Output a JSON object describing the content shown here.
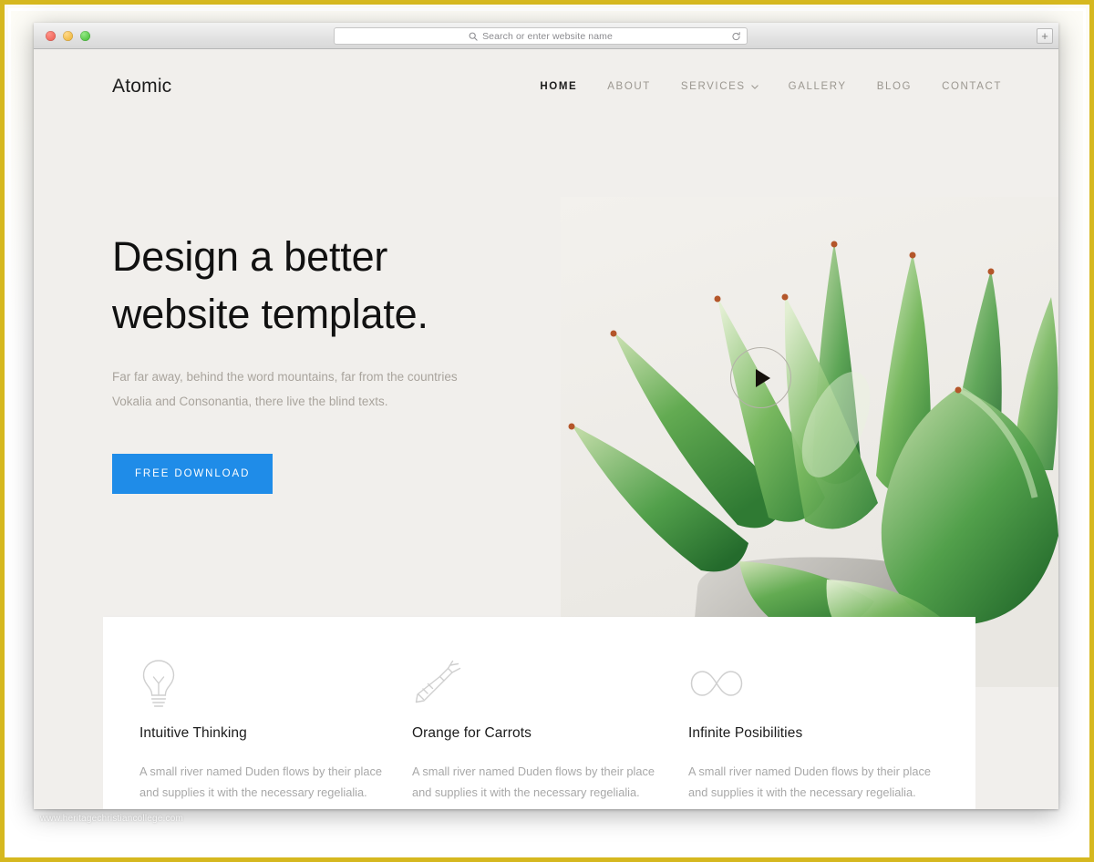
{
  "browser": {
    "address_placeholder": "Search or enter website name",
    "search_icon": "search-icon",
    "reload_icon": "reload-icon",
    "new_tab_label": "+",
    "traffic_lights": [
      "close",
      "minimize",
      "maximize"
    ]
  },
  "site": {
    "logo": "Atomic",
    "nav": [
      {
        "label": "HOME",
        "active": true,
        "has_caret": false
      },
      {
        "label": "ABOUT",
        "active": false,
        "has_caret": false
      },
      {
        "label": "SERVICES",
        "active": false,
        "has_caret": true
      },
      {
        "label": "GALLERY",
        "active": false,
        "has_caret": false
      },
      {
        "label": "BLOG",
        "active": false,
        "has_caret": false
      },
      {
        "label": "CONTACT",
        "active": false,
        "has_caret": false
      }
    ]
  },
  "hero": {
    "title_line1": "Design a better",
    "title_line2": "website template.",
    "subtitle": "Far far away, behind the word mountains, far from the countries Vokalia and Consonantia, there live the blind texts.",
    "cta_label": "FREE DOWNLOAD",
    "play_button_name": "play-video-button",
    "image_alt": "succulent-plant-in-grey-pot"
  },
  "features": [
    {
      "icon": "lightbulb-icon",
      "title": "Intuitive Thinking",
      "body": "A small river named Duden flows by their place and supplies it with the necessary regelialia."
    },
    {
      "icon": "carrot-icon",
      "title": "Orange for Carrots",
      "body": "A small river named Duden flows by their place and supplies it with the necessary regelialia."
    },
    {
      "icon": "infinity-icon",
      "title": "Infinite Posibilities",
      "body": "A small river named Duden flows by their place and supplies it with the necessary regelialia."
    }
  ],
  "watermark": "www.heritagechristiancollege.com",
  "colors": {
    "accent_blue": "#1f8ce8",
    "page_background": "#f1efec",
    "card_background": "#ffffff",
    "frame_gold": "#d6b81f",
    "heading_text": "#111111",
    "muted_text": "#a9a49d"
  }
}
